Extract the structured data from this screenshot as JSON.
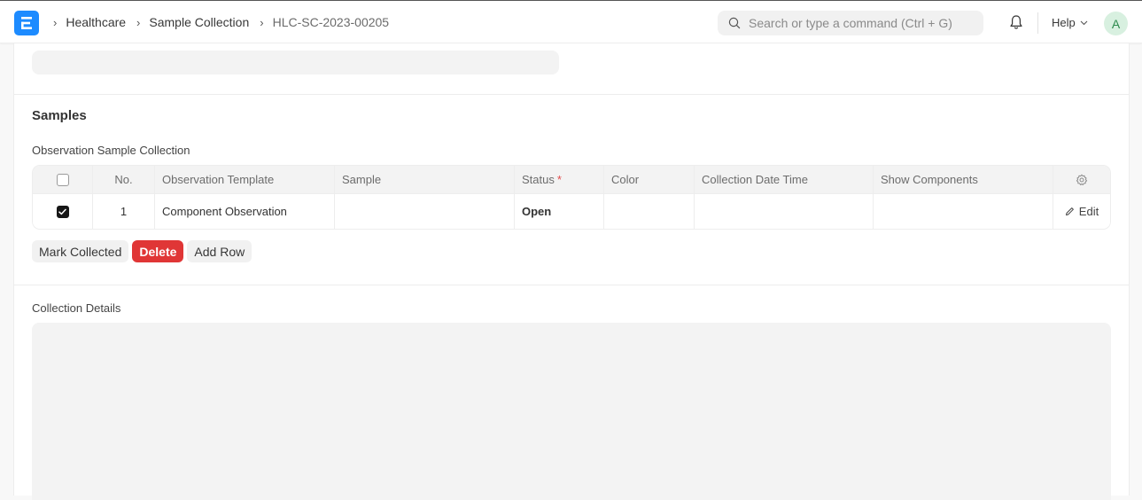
{
  "navbar": {
    "logo_letter": "E",
    "breadcrumbs": [
      "Healthcare",
      "Sample Collection",
      "HLC-SC-2023-00205"
    ],
    "search_placeholder": "Search or type a command (Ctrl + G)",
    "help_label": "Help",
    "avatar_initial": "A"
  },
  "samples_section": {
    "title": "Samples",
    "grid_label": "Observation Sample Collection",
    "columns": {
      "no": "No.",
      "observation_template": "Observation Template",
      "sample": "Sample",
      "status": "Status",
      "status_required_marker": "*",
      "color": "Color",
      "collection_date_time": "Collection Date Time",
      "show_components": "Show Components"
    },
    "rows": [
      {
        "checked": true,
        "no": "1",
        "observation_template": "Component Observation",
        "sample": "",
        "status": "Open",
        "color": "",
        "collection_date_time": "",
        "show_components": "",
        "edit_label": "Edit"
      }
    ],
    "buttons": {
      "mark_collected": "Mark Collected",
      "delete": "Delete",
      "add_row": "Add Row"
    }
  },
  "collection_details": {
    "label": "Collection Details",
    "value": ""
  },
  "colors": {
    "brand": "#1d8bff",
    "danger": "#e03636",
    "avatar_bg": "#d8f0e0",
    "avatar_fg": "#2d8a4e"
  }
}
